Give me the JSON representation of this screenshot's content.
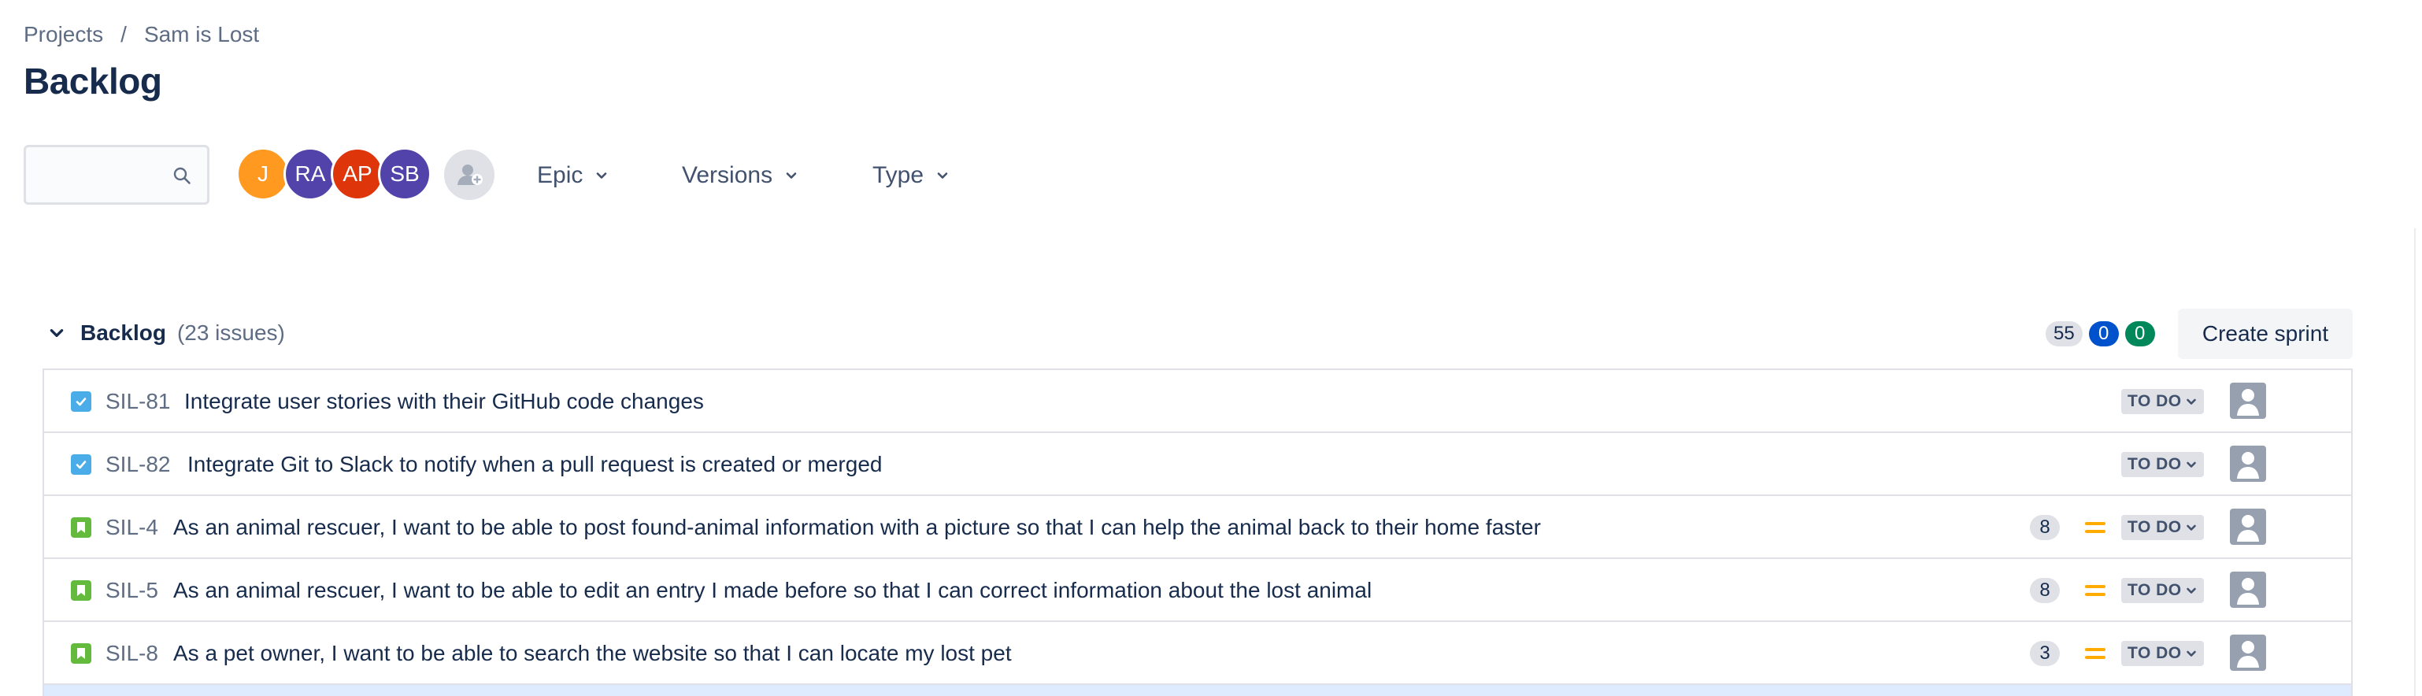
{
  "breadcrumb": {
    "projects": "Projects",
    "separator": "/",
    "project": "Sam is Lost"
  },
  "page_title": "Backlog",
  "search": {
    "placeholder": "",
    "value": "",
    "icon": "search-icon"
  },
  "avatars": [
    {
      "initials": "J",
      "color": "#ff991f"
    },
    {
      "initials": "RA",
      "color": "#5243aa"
    },
    {
      "initials": "AP",
      "color": "#de350b"
    },
    {
      "initials": "SB",
      "color": "#5243aa"
    }
  ],
  "filters": {
    "epic": "Epic",
    "versions": "Versions",
    "type": "Type"
  },
  "backlog": {
    "name": "Backlog",
    "issue_count": "(23 issues)",
    "counts": {
      "not_started": "55",
      "in_progress": "0",
      "done": "0"
    },
    "create_sprint": "Create sprint"
  },
  "issues": [
    {
      "type": "task",
      "key": "SIL-81",
      "summary": "Integrate user stories with their GitHub code changes",
      "estimate": "",
      "priority": "",
      "status": "TO DO"
    },
    {
      "type": "task",
      "key": "SIL-82",
      "summary": "Integrate Git to Slack to notify when a pull request is created or merged",
      "estimate": "",
      "priority": "",
      "status": "TO DO"
    },
    {
      "type": "story",
      "key": "SIL-4",
      "summary": "As an animal rescuer, I want to be able to post found-animal information with a picture so that I can help the animal back to their home faster",
      "estimate": "8",
      "priority": "medium",
      "status": "TO DO"
    },
    {
      "type": "story",
      "key": "SIL-5",
      "summary": "As an animal rescuer, I want to be able to edit an entry I made before so that I can correct information about the lost animal",
      "estimate": "8",
      "priority": "medium",
      "status": "TO DO"
    },
    {
      "type": "story",
      "key": "SIL-8",
      "summary": "As a pet owner, I want to be able to search the website so that I can locate my lost pet",
      "estimate": "3",
      "priority": "medium",
      "status": "TO DO"
    }
  ],
  "colors": {
    "task": "#4bade8",
    "story": "#63ba3c",
    "priority_medium": "#ffab00",
    "brand": "#0052cc"
  }
}
